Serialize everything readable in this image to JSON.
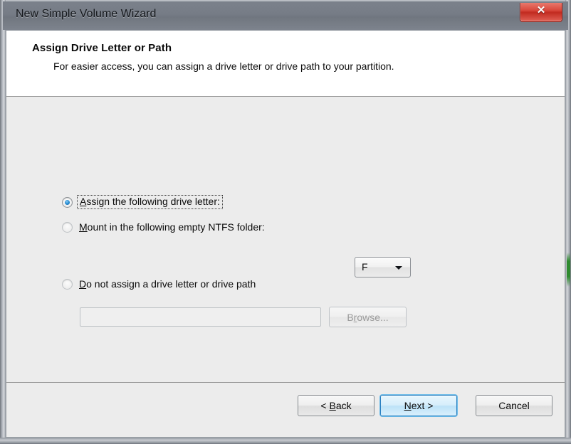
{
  "window": {
    "title": "New Simple Volume Wizard",
    "close_label": "✕",
    "close_icon": "close-icon"
  },
  "header": {
    "title": "Assign Drive Letter or Path",
    "subtitle": "For easier access, you can assign a drive letter or drive path to your partition."
  },
  "options": {
    "assign_letter": {
      "label": "Assign the following drive letter:",
      "accelerator": "A",
      "selected": true
    },
    "mount_folder": {
      "label": "Mount in the following empty NTFS folder:",
      "accelerator": "M",
      "selected": false
    },
    "no_letter": {
      "label": "Do not assign a drive letter or drive path",
      "accelerator": "D",
      "selected": false
    }
  },
  "drive_letter_combo": {
    "value": "F",
    "arrow_icon": "chevron-down-icon"
  },
  "mount_path_field": {
    "value": "",
    "placeholder": ""
  },
  "browse_button": {
    "label": "Browse...",
    "accelerator": "r",
    "enabled": false
  },
  "footer": {
    "back_label": "< Back",
    "back_accelerator": "B",
    "next_label": "Next >",
    "next_accelerator": "N",
    "cancel_label": "Cancel"
  },
  "colors": {
    "titlebar": "#767c86",
    "dialog_background": "#ececec",
    "header_background": "#ffffff",
    "close_red": "#c22b20",
    "default_button_blue": "#2a7fc0",
    "radio_blue": "#2a8fd4"
  }
}
